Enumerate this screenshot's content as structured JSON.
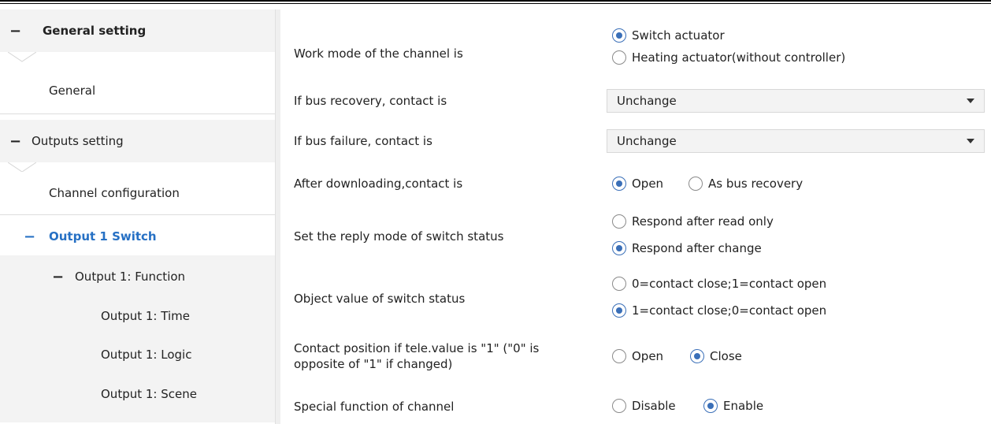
{
  "sidebar": {
    "items": [
      {
        "label": "General setting"
      },
      {
        "label": "General"
      },
      {
        "label": "Outputs setting"
      },
      {
        "label": "Channel configuration"
      },
      {
        "label": "Output 1 Switch"
      },
      {
        "label": "Output 1: Function"
      },
      {
        "label": "Output 1: Time"
      },
      {
        "label": "Output 1: Logic"
      },
      {
        "label": "Output 1: Scene"
      }
    ]
  },
  "params": {
    "work_mode": {
      "label": "Work mode of the channel is",
      "options": [
        "Switch actuator",
        "Heating actuator(without controller)"
      ],
      "selected": "Switch actuator"
    },
    "bus_recovery": {
      "label": "If bus recovery, contact is",
      "value": "Unchange"
    },
    "bus_failure": {
      "label": "If bus failure, contact is",
      "value": "Unchange"
    },
    "after_download": {
      "label": "After downloading,contact is",
      "options": [
        "Open",
        "As bus recovery"
      ],
      "selected": "Open"
    },
    "reply_mode": {
      "label": "Set the reply mode of switch status",
      "options": [
        "Respond after read only",
        "Respond after change"
      ],
      "selected": "Respond after change"
    },
    "object_value": {
      "label": "Object value of switch status",
      "options": [
        "0=contact close;1=contact open",
        "1=contact close;0=contact open"
      ],
      "selected": "1=contact close;0=contact open"
    },
    "contact_position": {
      "label_line1": "Contact position if tele.value is \"1\" (\"0\" is",
      "label_line2": "opposite of \"1\" if changed)",
      "options": [
        "Open",
        "Close"
      ],
      "selected": "Close"
    },
    "special_function": {
      "label": "Special function of channel",
      "options": [
        "Disable",
        "Enable"
      ],
      "selected": "Enable"
    }
  },
  "colors": {
    "accent": "#2670c4",
    "radio_selected": "#3a6fb8"
  }
}
